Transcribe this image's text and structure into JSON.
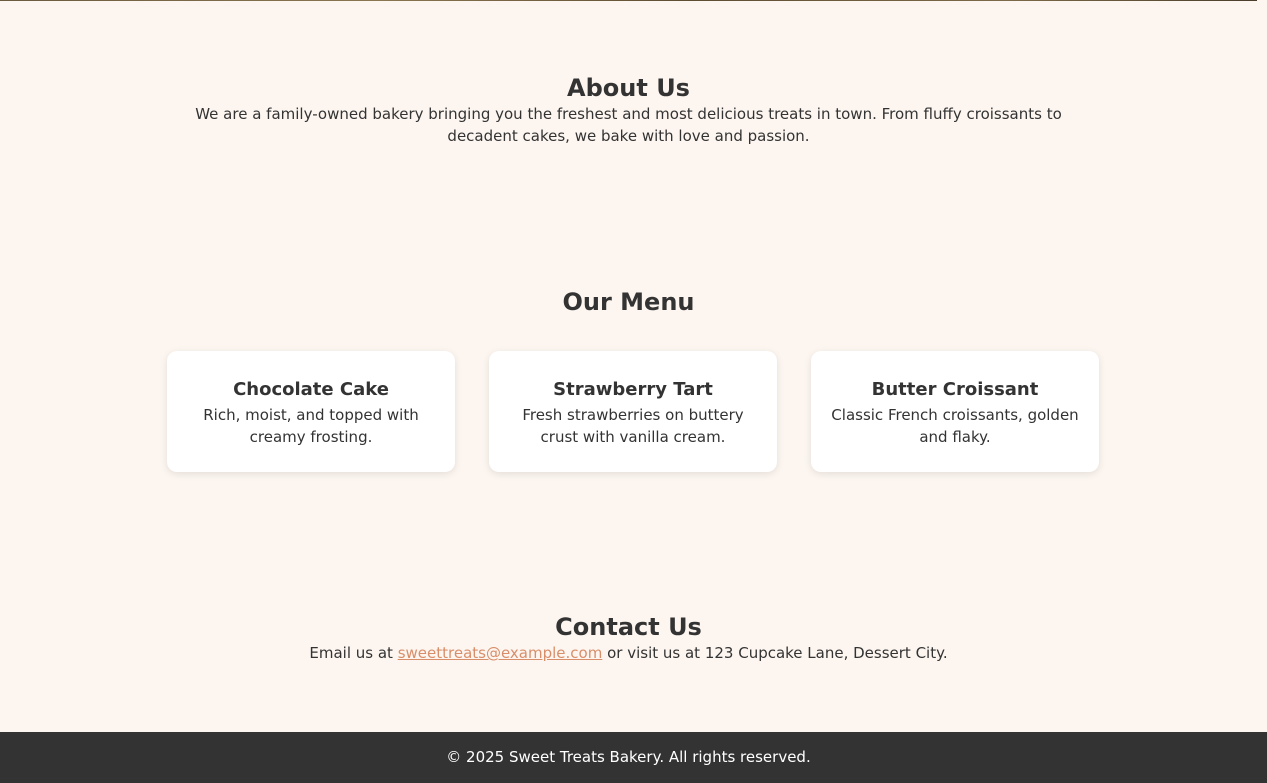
{
  "about": {
    "title": "About Us",
    "text": "We are a family-owned bakery bringing you the freshest and most delicious treats in town. From fluffy croissants to decadent cakes, we bake with love and passion."
  },
  "menu": {
    "title": "Our Menu",
    "items": [
      {
        "name": "Chocolate Cake",
        "description": "Rich, moist, and topped with creamy frosting."
      },
      {
        "name": "Strawberry Tart",
        "description": "Fresh strawberries on buttery crust with vanilla cream."
      },
      {
        "name": "Butter Croissant",
        "description": "Classic French croissants, golden and flaky."
      }
    ]
  },
  "contact": {
    "title": "Contact Us",
    "prefix": "Email us at ",
    "email": "sweettreats@example.com",
    "suffix": " or visit us at 123 Cupcake Lane, Dessert City."
  },
  "footer": {
    "text": "© 2025 Sweet Treats Bakery. All rights reserved."
  },
  "colors": {
    "background": "#fdf6f0",
    "text": "#333333",
    "card": "#ffffff",
    "link": "#d98e6a",
    "footer": "#333333"
  }
}
